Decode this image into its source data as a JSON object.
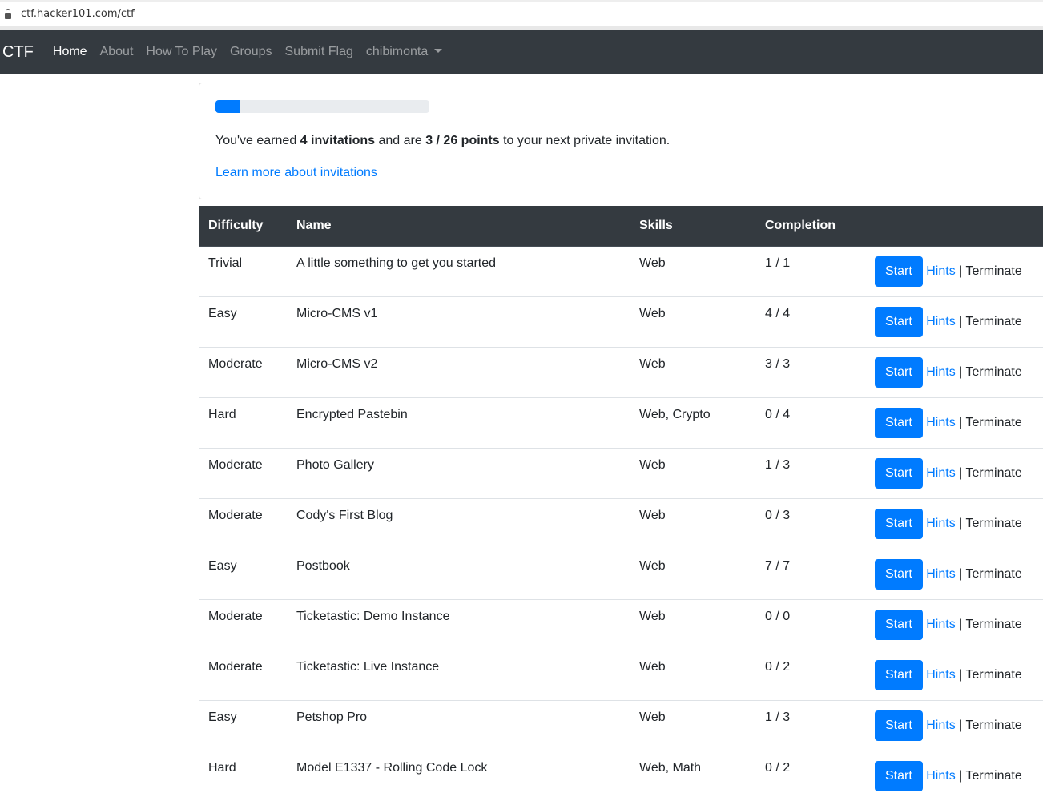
{
  "browser": {
    "url": "ctf.hacker101.com/ctf"
  },
  "nav": {
    "brand": "CTF",
    "links": [
      "Home",
      "About",
      "How To Play",
      "Groups",
      "Submit Flag"
    ],
    "user": "chibimonta"
  },
  "invitations": {
    "progress_percent": 11.5,
    "prefix": "You've earned ",
    "count": "4 invitations",
    "middle": " and are ",
    "points": "3 / 26 points",
    "suffix": " to your next private invitation.",
    "learn_more": "Learn more about invitations"
  },
  "table": {
    "headers": [
      "Difficulty",
      "Name",
      "Skills",
      "Completion",
      ""
    ],
    "rows": [
      [
        "Trivial",
        "A little something to get you started",
        "Web",
        "1 / 1"
      ],
      [
        "Easy",
        "Micro-CMS v1",
        "Web",
        "4 / 4"
      ],
      [
        "Moderate",
        "Micro-CMS v2",
        "Web",
        "3 / 3"
      ],
      [
        "Hard",
        "Encrypted Pastebin",
        "Web, Crypto",
        "0 / 4"
      ],
      [
        "Moderate",
        "Photo Gallery",
        "Web",
        "1 / 3"
      ],
      [
        "Moderate",
        "Cody's First Blog",
        "Web",
        "0 / 3"
      ],
      [
        "Easy",
        "Postbook",
        "Web",
        "7 / 7"
      ],
      [
        "Moderate",
        "Ticketastic: Demo Instance",
        "Web",
        "0 / 0"
      ],
      [
        "Moderate",
        "Ticketastic: Live Instance",
        "Web",
        "0 / 2"
      ],
      [
        "Easy",
        "Petshop Pro",
        "Web",
        "1 / 3"
      ],
      [
        "Hard",
        "Model E1337 - Rolling Code Lock",
        "Web, Math",
        "0 / 2"
      ]
    ],
    "actions": {
      "start": "Start",
      "hints": "Hints",
      "sep": " | ",
      "terminate": "Terminate"
    }
  }
}
